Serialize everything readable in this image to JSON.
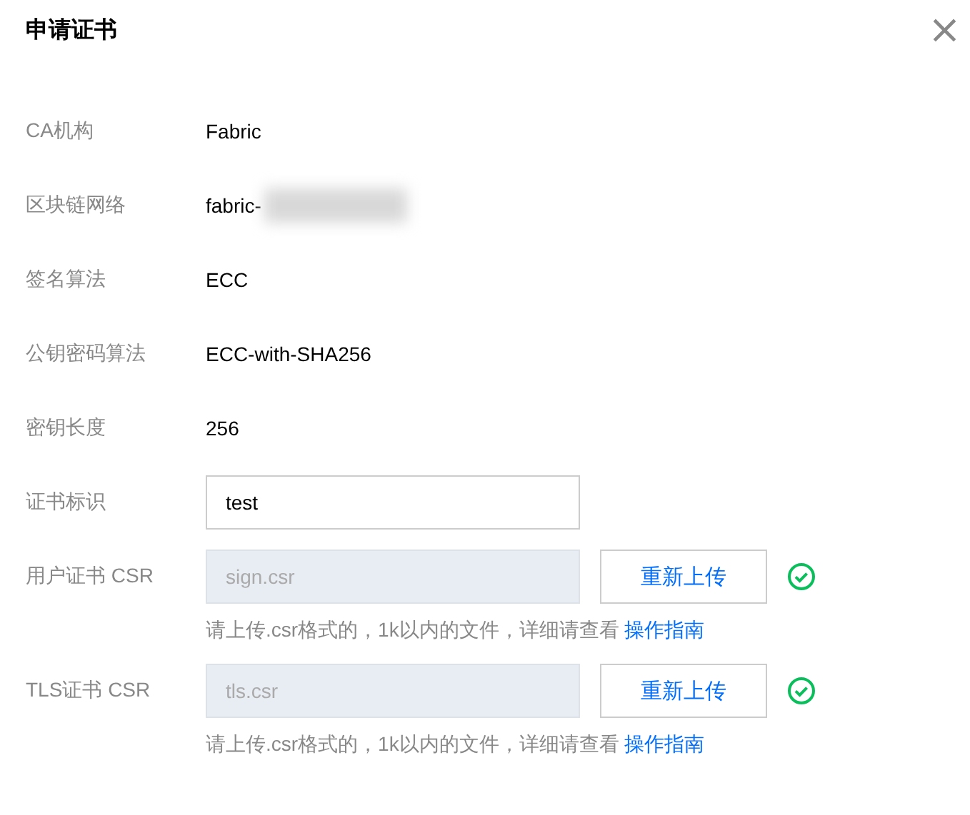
{
  "dialog": {
    "title": "申请证书",
    "close": "×"
  },
  "fields": [
    {
      "kind": "text",
      "label": "CA机构",
      "value": "Fabric"
    },
    {
      "kind": "text",
      "label": "区块链网络",
      "value": "fabric-",
      "redacted": true
    },
    {
      "kind": "text",
      "label": "签名算法",
      "value": "ECC"
    },
    {
      "kind": "text",
      "label": "公钥密码算法",
      "value": "ECC-with-SHA256"
    },
    {
      "kind": "text",
      "label": "密钥长度",
      "value": "256"
    },
    {
      "kind": "input",
      "label": "证书标识",
      "value": "test"
    },
    {
      "kind": "upload",
      "label": "用户证书 CSR",
      "value": "sign.csr",
      "disabled": true,
      "button": "重新上传",
      "uploaded": true,
      "hint": "请上传.csr格式的，1k以内的文件，详细请查看",
      "link": "操作指南"
    },
    {
      "kind": "upload",
      "label": "TLS证书 CSR",
      "value": "tls.csr",
      "disabled": true,
      "button": "重新上传",
      "uploaded": true,
      "hint": "请上传.csr格式的，1k以内的文件，详细请查看",
      "link": "操作指南"
    }
  ]
}
